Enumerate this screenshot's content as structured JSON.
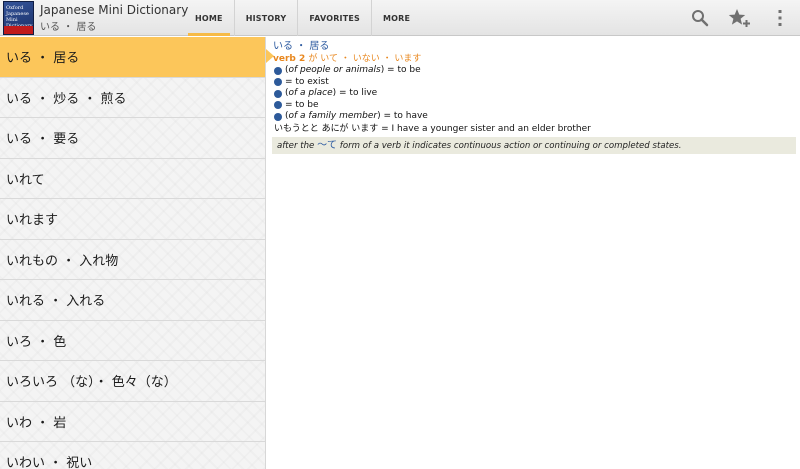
{
  "app": {
    "title": "Japanese Mini Dictionary",
    "subtitle": "いる ・ 居る",
    "icon_text": [
      "Oxford",
      "Japanese",
      "Mini",
      "Dictionary"
    ]
  },
  "tabs": [
    {
      "label": "HOME",
      "active": true
    },
    {
      "label": "HISTORY",
      "active": false
    },
    {
      "label": "FAVORITES",
      "active": false
    },
    {
      "label": "MORE",
      "active": false
    }
  ],
  "actions": [
    "search-icon",
    "star-add-icon",
    "overflow-menu-icon"
  ],
  "word_list": [
    "いる ・ 居る",
    "いる ・ 炒る ・ 煎る",
    "いる ・ 要る",
    "いれて",
    "いれます",
    "いれもの ・ 入れ物",
    "いれる ・ 入れる",
    "いろ ・ 色",
    "いろいろ （な）・ 色々（な）",
    "いわ ・ 岩",
    "いわい ・ 祝い"
  ],
  "selected_index": 0,
  "entry": {
    "headword": "いる ・ 居る",
    "pos": "verb 2",
    "forms": "が いて ・ いない ・ います",
    "senses": [
      {
        "prefix": "(",
        "qualifier": "of people or animals",
        "suffix": ") = to be"
      },
      {
        "prefix": "",
        "qualifier": "",
        "suffix": "= to exist"
      },
      {
        "prefix": "(",
        "qualifier": "of a place",
        "suffix": ") = to live"
      },
      {
        "prefix": "",
        "qualifier": "",
        "suffix": "= to be"
      },
      {
        "prefix": "(",
        "qualifier": "of a family member",
        "suffix": ") = to have"
      }
    ],
    "example": "いもうとと あにが います = I have a younger sister and an elder brother",
    "note_before": "after the ",
    "note_kana": "～て",
    "note_after": " form of a verb it indicates continuous action or continuing or completed states."
  },
  "colors": {
    "accent": "#fcc65a",
    "headword": "#2c5aa0",
    "grammar": "#e8871e",
    "bullet": "#2d5a9a",
    "note_bg": "#eaeade"
  }
}
